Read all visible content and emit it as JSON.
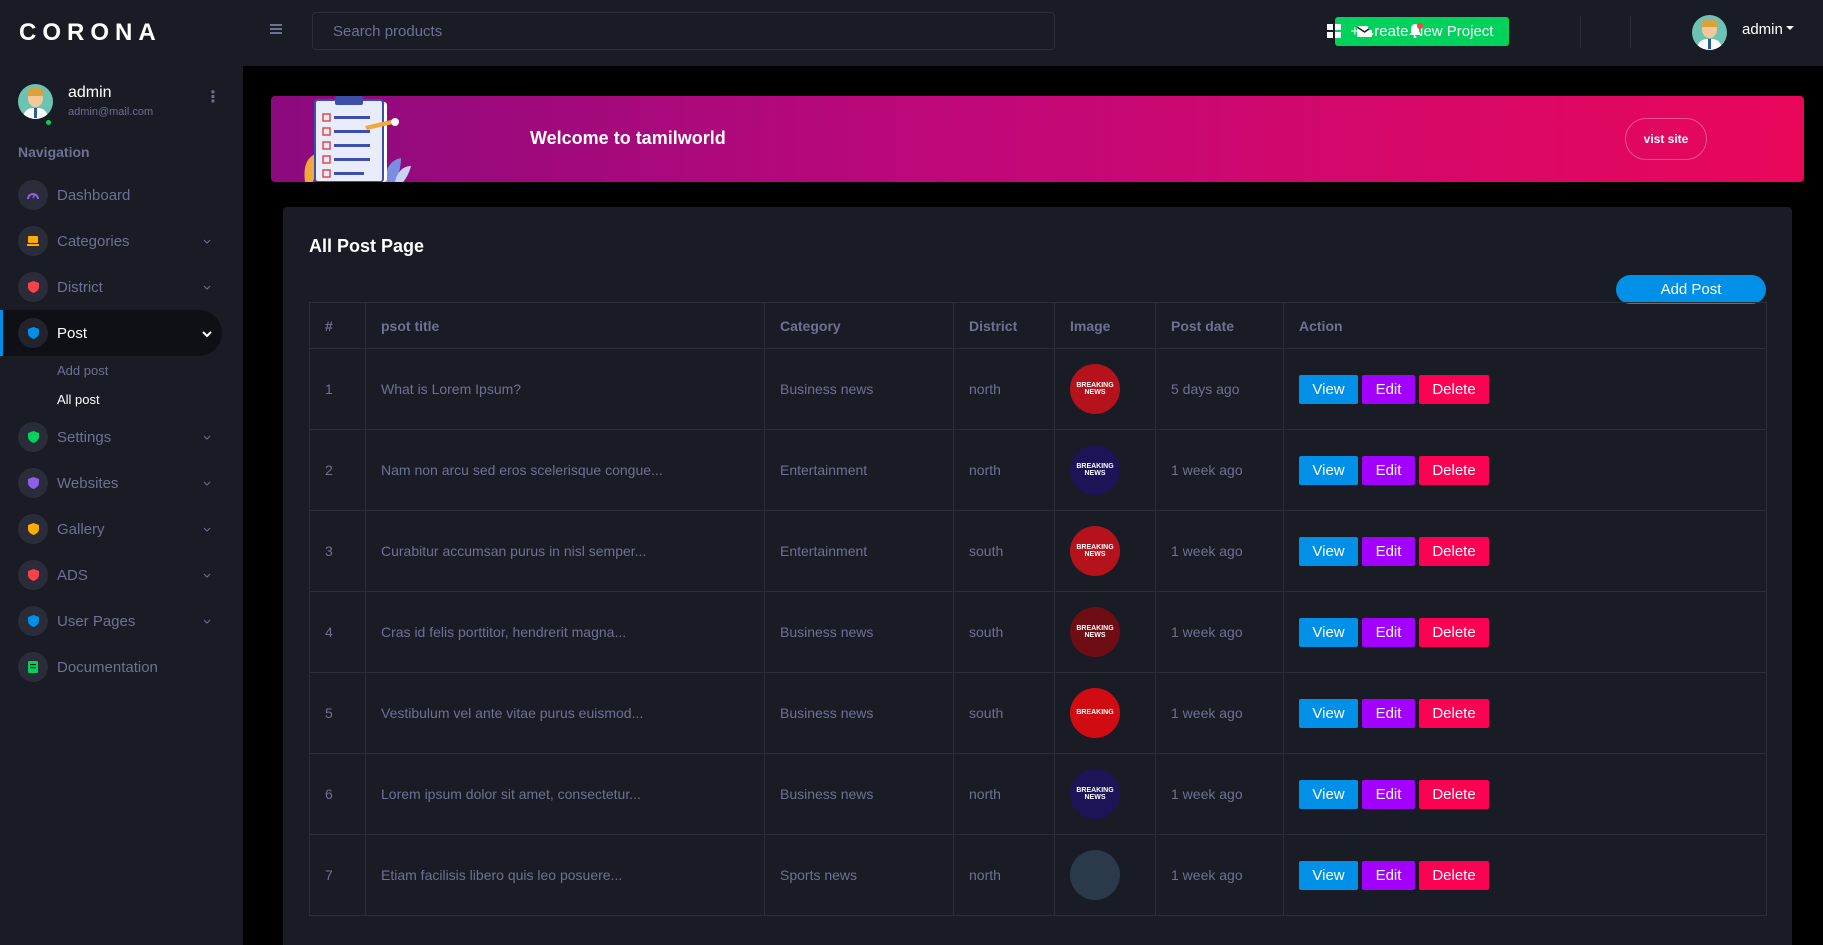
{
  "brand": "CORONA",
  "profile": {
    "name": "admin",
    "email": "admin@mail.com"
  },
  "nav": {
    "heading": "Navigation",
    "items": [
      {
        "label": "Dashboard",
        "icon": "speedometer-icon",
        "color": "#8f5fe8",
        "has_arrow": false
      },
      {
        "label": "Categories",
        "icon": "laptop-icon",
        "color": "#ffab00",
        "has_arrow": true
      },
      {
        "label": "District",
        "icon": "shield-icon",
        "color": "#fc424a",
        "has_arrow": true
      },
      {
        "label": "Post",
        "icon": "shield-icon",
        "color": "#0090e7",
        "has_arrow": true,
        "active": true
      },
      {
        "label": "Settings",
        "icon": "shield-icon",
        "color": "#00d25b",
        "has_arrow": true
      },
      {
        "label": "Websites",
        "icon": "shield-icon",
        "color": "#8f5fe8",
        "has_arrow": true
      },
      {
        "label": "Gallery",
        "icon": "shield-icon",
        "color": "#ffab00",
        "has_arrow": true
      },
      {
        "label": "ADS",
        "icon": "shield-icon",
        "color": "#fc424a",
        "has_arrow": true
      },
      {
        "label": "User Pages",
        "icon": "shield-icon",
        "color": "#0090e7",
        "has_arrow": true
      },
      {
        "label": "Documentation",
        "icon": "document-icon",
        "color": "#00d25b",
        "has_arrow": false
      }
    ],
    "post_sub": [
      "Add post",
      "All post"
    ]
  },
  "navbar": {
    "search_placeholder": "Search products",
    "create_label": "+ Create New Project",
    "user": "admin"
  },
  "banner": {
    "text": "Welcome to tamilworld",
    "button": "vist site"
  },
  "card": {
    "title": "All Post Page",
    "add_button": "Add Post",
    "columns": [
      "#",
      "psot title",
      "Category",
      "District",
      "Image",
      "Post date",
      "Action"
    ],
    "rows": [
      {
        "n": "1",
        "title": "What is Lorem Ipsum?",
        "category": "Business news",
        "district": "north",
        "thumb": "BREAKING NEWS",
        "thumb_color": "#b5121b",
        "date": "5 days ago"
      },
      {
        "n": "2",
        "title": "Nam non arcu sed eros scelerisque congue...",
        "category": "Entertainment",
        "district": "north",
        "thumb": "BREAKING NEWS",
        "thumb_color": "#1b1457",
        "date": "1 week ago"
      },
      {
        "n": "3",
        "title": "Curabitur accumsan purus in nisl semper...",
        "category": "Entertainment",
        "district": "south",
        "thumb": "BREAKING NEWS",
        "thumb_color": "#b5121b",
        "date": "1 week ago"
      },
      {
        "n": "4",
        "title": "Cras id felis porttitor, hendrerit magna...",
        "category": "Business news",
        "district": "south",
        "thumb": "BREAKING NEWS",
        "thumb_color": "#6e0d14",
        "date": "1 week ago"
      },
      {
        "n": "5",
        "title": "Vestibulum vel ante vitae purus euismod...",
        "category": "Business news",
        "district": "south",
        "thumb": "BREAKING",
        "thumb_color": "#d00c12",
        "date": "1 week ago"
      },
      {
        "n": "6",
        "title": "Lorem ipsum dolor sit amet, consectetur...",
        "category": "Business news",
        "district": "north",
        "thumb": "BREAKING NEWS",
        "thumb_color": "#1b1457",
        "date": "1 week ago"
      },
      {
        "n": "7",
        "title": "Etiam facilisis libero quis leo posuere...",
        "category": "Sports news",
        "district": "north",
        "thumb": "",
        "thumb_color": "#2a3a4a",
        "date": "1 week ago"
      }
    ],
    "actions": {
      "view": "View",
      "edit": "Edit",
      "delete": "Delete"
    }
  },
  "colors": {
    "accent_blue": "#0090e7",
    "accent_green": "#00d25b",
    "accent_purple": "#a200ff",
    "accent_red": "#fc0052",
    "sidebar_bg": "#191c24"
  }
}
